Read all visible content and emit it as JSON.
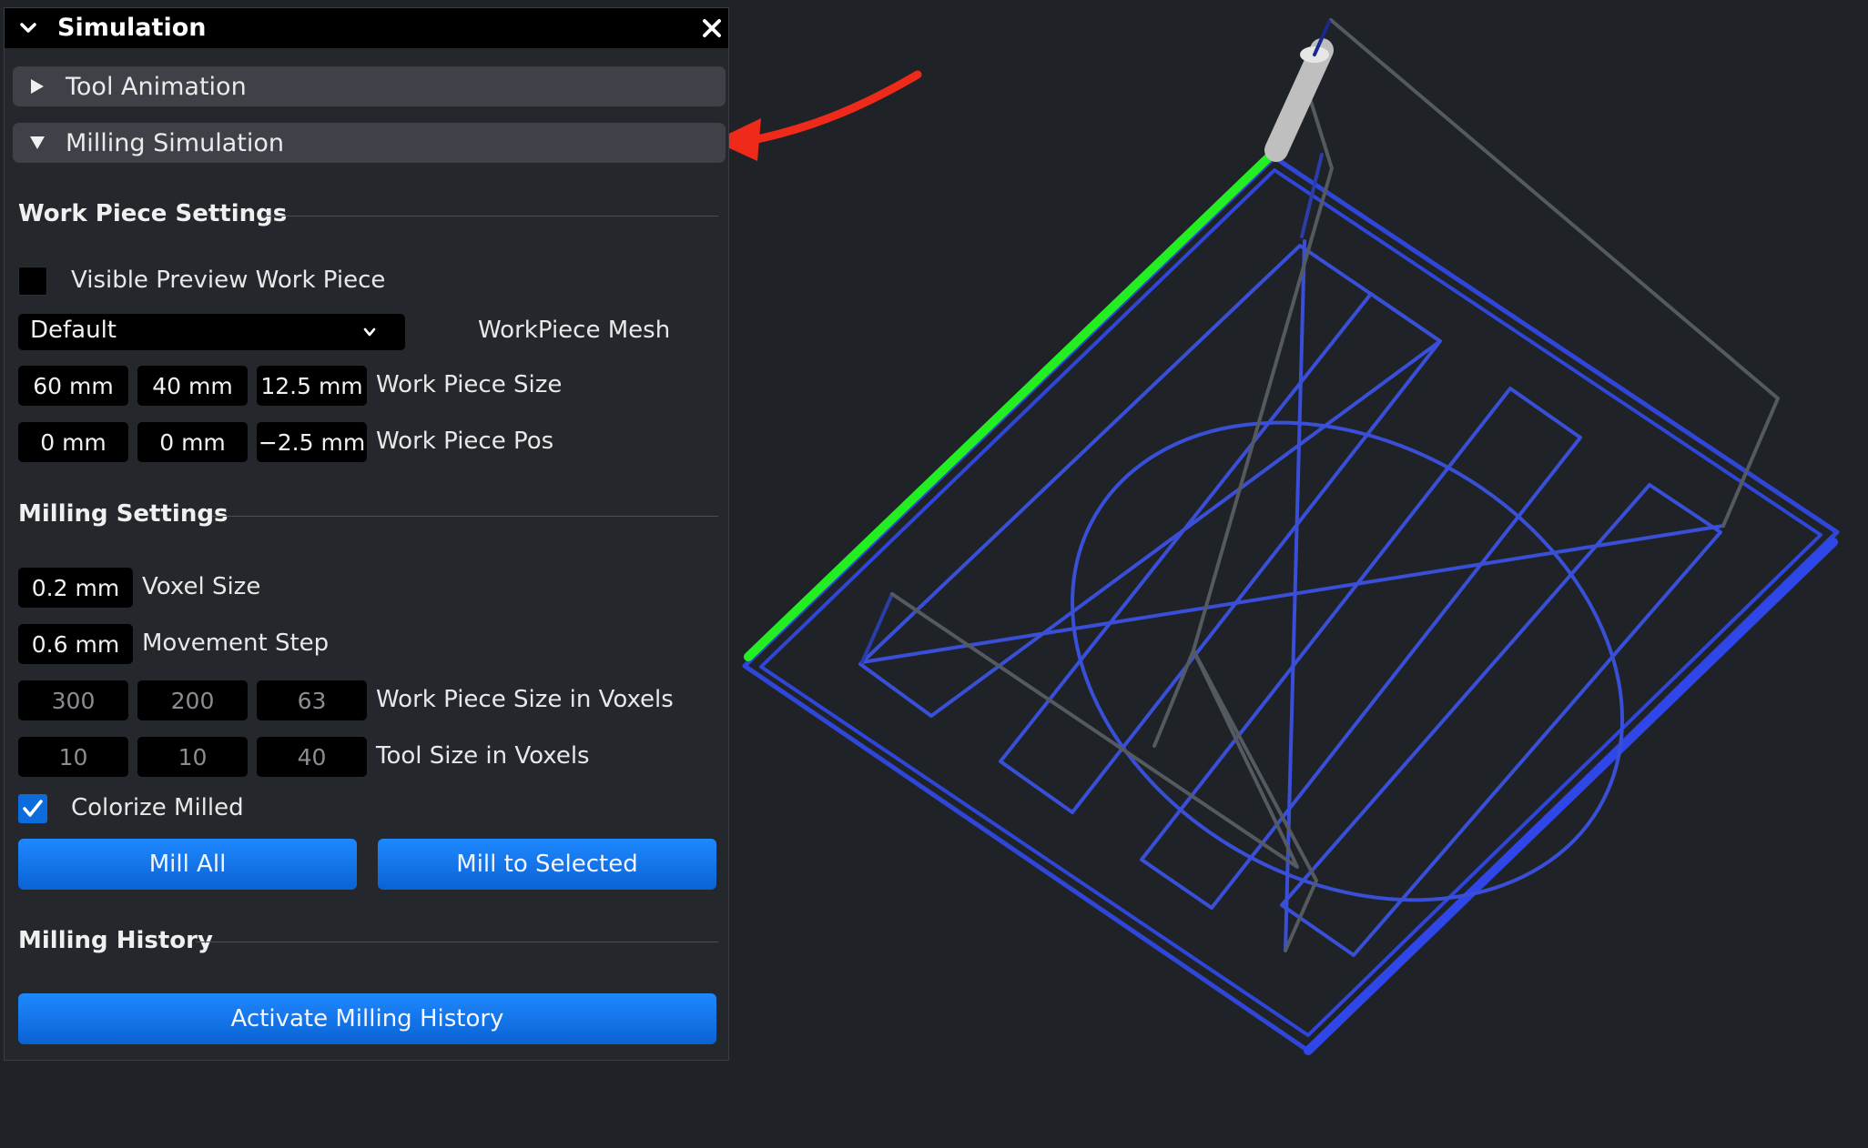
{
  "panel": {
    "title": "Simulation",
    "sections": {
      "tool_animation": "Tool Animation",
      "milling_simulation": "Milling Simulation"
    }
  },
  "work_piece_settings": {
    "title": "Work Piece Settings",
    "visible_preview_label": "Visible Preview Work Piece",
    "visible_preview_checked": false,
    "mesh_selected": "Default",
    "mesh_label": "WorkPiece Mesh",
    "size_values": [
      "60 mm",
      "40 mm",
      "12.5 mm"
    ],
    "size_label": "Work Piece Size",
    "pos_values": [
      "0 mm",
      "0 mm",
      "−2.5 mm"
    ],
    "pos_label": "Work Piece Pos"
  },
  "milling_settings": {
    "title": "Milling Settings",
    "voxel_size_value": "0.2 mm",
    "voxel_size_label": "Voxel Size",
    "movement_step_value": "0.6 mm",
    "movement_step_label": "Movement Step",
    "voxels_values": [
      "300",
      "200",
      "63"
    ],
    "voxels_label": "Work Piece Size in Voxels",
    "tool_voxels_values": [
      "10",
      "10",
      "40"
    ],
    "tool_voxels_label": "Tool Size in Voxels",
    "colorize_label": "Colorize Milled",
    "colorize_checked": true,
    "mill_all_label": "Mill All",
    "mill_to_selected_label": "Mill to Selected"
  },
  "milling_history": {
    "title": "Milling History",
    "activate_label": "Activate Milling History"
  },
  "icons": {
    "collapse": "chevron-down-icon",
    "close": "close-icon",
    "collapsed": "triangle-right-icon",
    "expanded": "triangle-down-icon",
    "dropdown": "chevron-down-icon",
    "check": "checkmark-icon",
    "annotation": "red-arrow-icon"
  },
  "colors": {
    "background": "#1f2328",
    "panel": "#24272c",
    "accent_blue": "#1a7af0",
    "toolpath_blue": "#3a4fd8",
    "selected_path_green": "#22ee22",
    "rapid_move_gray": "#555a60",
    "annotation_red": "#f02a1a"
  }
}
